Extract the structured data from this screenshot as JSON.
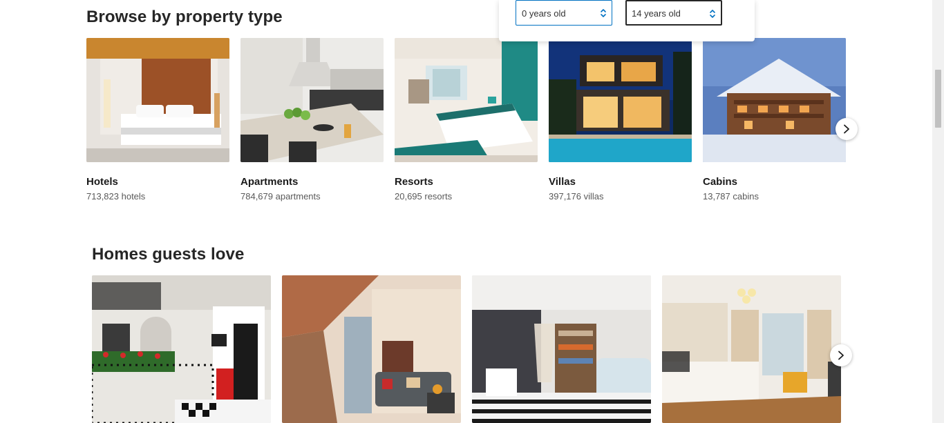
{
  "sections": {
    "browse_title": "Browse by property type",
    "homes_title": "Homes guests love"
  },
  "property_types": [
    {
      "name": "Hotels",
      "count": "713,823 hotels"
    },
    {
      "name": "Apartments",
      "count": "784,679 apartments"
    },
    {
      "name": "Resorts",
      "count": "20,695 resorts"
    },
    {
      "name": "Villas",
      "count": "397,176 villas"
    },
    {
      "name": "Cabins",
      "count": "13,787 cabins"
    }
  ],
  "age_selects": [
    {
      "value": "0 years old"
    },
    {
      "value": "14 years old"
    }
  ],
  "icons": {
    "next": "chevron-right-icon",
    "select": "up-down-arrows-icon"
  },
  "colors": {
    "focus_border": "#0071c2",
    "select_arrow": "#0071c2"
  }
}
